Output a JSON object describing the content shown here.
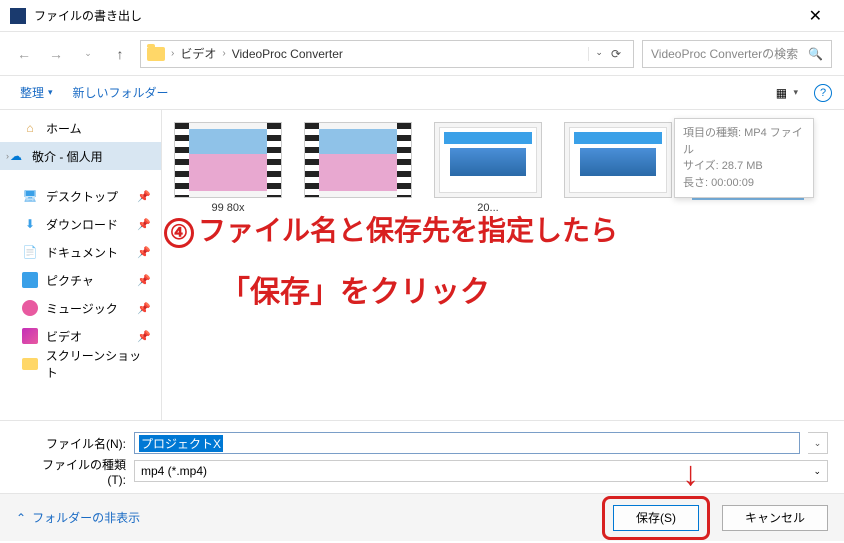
{
  "title": "ファイルの書き出し",
  "path": {
    "seg1": "ビデオ",
    "seg2": "VideoProc Converter"
  },
  "search_placeholder": "VideoProc Converterの検索",
  "toolbar": {
    "organize": "整理",
    "new_folder": "新しいフォルダー"
  },
  "sidebar": {
    "home": "ホーム",
    "personal": "敬介 - 個人用",
    "desktop": "デスクトップ",
    "downloads": "ダウンロード",
    "documents": "ドキュメント",
    "pictures": "ピクチャ",
    "music": "ミュージック",
    "videos": "ビデオ",
    "screenshots": "スクリーンショット"
  },
  "thumbs": {
    "t1": "99   80x",
    "t2": "",
    "t3": "20...",
    "t4": "",
    "t5": ""
  },
  "tooltip": {
    "line1": "項目の種類: MP4 ファイル",
    "line2": "サイズ: 28.7 MB",
    "line3": "長さ: 00:00:09"
  },
  "annotation": {
    "num": "④",
    "line1": "ファイル名と保存先を指定したら",
    "line2": "「保存」をクリック"
  },
  "fields": {
    "filename_label": "ファイル名(N):",
    "filename_value": "プロジェクトX",
    "filetype_label": "ファイルの種類(T):",
    "filetype_value": "mp4 (*.mp4)"
  },
  "footer": {
    "hide_folders": "フォルダーの非表示",
    "save": "保存(S)",
    "cancel": "キャンセル"
  }
}
